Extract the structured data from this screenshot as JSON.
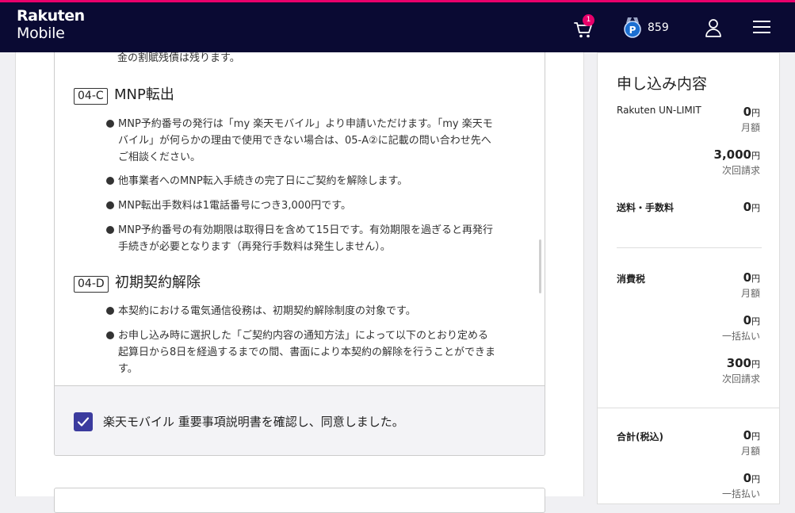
{
  "header": {
    "logo_line1": "Rakuten",
    "logo_line2": "Mobile",
    "cart_count": "1",
    "points": "859",
    "colors": {
      "background": "#0a0a33",
      "accent": "#e8006b"
    }
  },
  "document": {
    "intro_tail": "金の割賦残債は残ります。",
    "sections": [
      {
        "code": "04-C",
        "title": "MNP転出",
        "bullets": [
          [
            "MNP予約番号の発行は「my 楽天モバイル」より申請いただけます。「my 楽天モ",
            "バイル」が何らかの理由で使用できない場合は、05-A②に記載の問い合わせ先へ",
            "ご相談ください。"
          ],
          [
            "他事業者へのMNP転入手続きの完了日にご契約を解除します。"
          ],
          [
            "MNP転出手数料は1電話番号につき3,000円です。"
          ],
          [
            "MNP予約番号の有効期限は取得日を含めて15日です。有効期限を過ぎると再発行",
            "手続きが必要となります（再発行手数料は発生しません）。"
          ]
        ]
      },
      {
        "code": "04-D",
        "title": "初期契約解除",
        "bullets": [
          [
            "本契約における電気通信役務は、初期契約解除制度の対象です。"
          ],
          [
            "お申し込み時に選択した「ご契約内容の通知方法」によって以下のとおり定める",
            "起算日から8日を経過するまでの間、書面により本契約の解除を行うことができま",
            "す。"
          ]
        ]
      }
    ],
    "agreement_label": "楽天モバイル 重要事項説明書を確認し、同意しました。",
    "agreement_checked": true
  },
  "summary": {
    "title": "申し込み内容",
    "plan_name": "Rakuten UN-LIMIT",
    "plan_monthly": "0",
    "plan_monthly_note": "月額",
    "plan_next": "3,000",
    "plan_next_note": "次回請求",
    "shipping_label": "送料・手数料",
    "shipping_amount": "0",
    "tax_label": "消費税",
    "tax_monthly": "0",
    "tax_monthly_note": "月額",
    "tax_once": "0",
    "tax_once_note": "一括払い",
    "tax_next": "300",
    "tax_next_note": "次回請求",
    "total_label": "合計(税込)",
    "total_monthly": "0",
    "total_monthly_note": "月額",
    "total_once": "0",
    "total_once_note": "一括払い",
    "yen": "円"
  }
}
